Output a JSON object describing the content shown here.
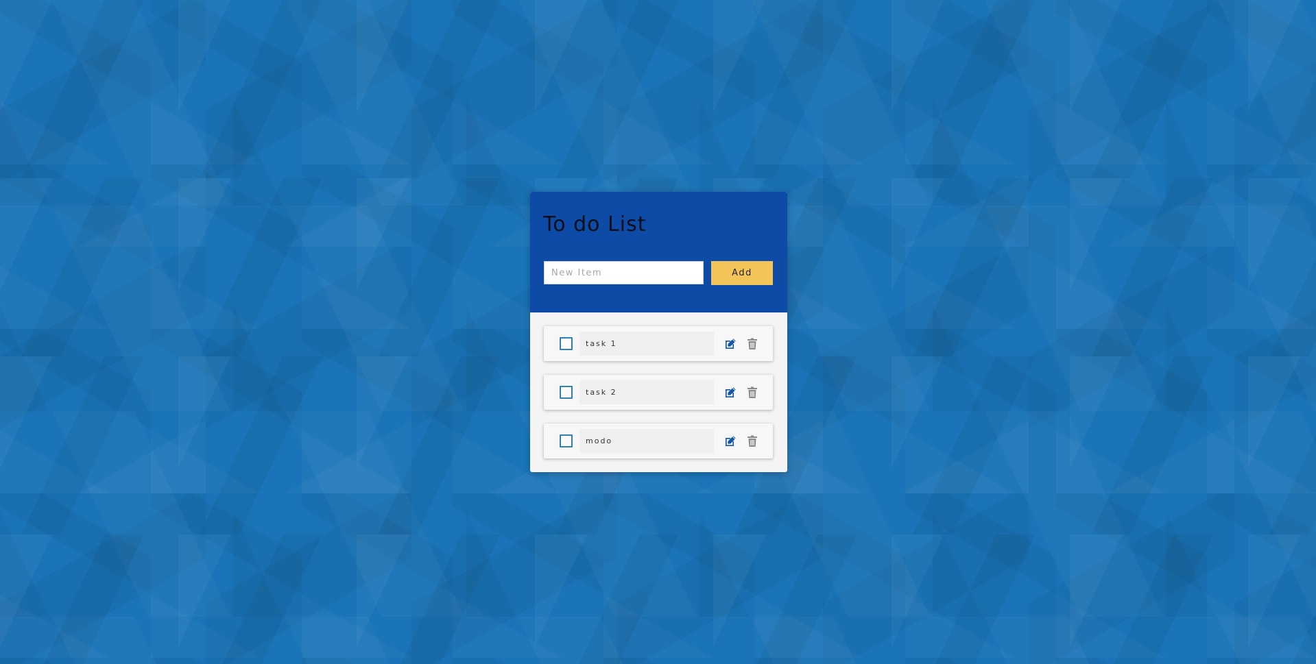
{
  "app": {
    "title": "To do List"
  },
  "form": {
    "input_value": "",
    "input_placeholder": "New Item",
    "add_label": "Add"
  },
  "tasks": [
    {
      "text": "task 1",
      "checked": false
    },
    {
      "text": "task 2",
      "checked": false
    },
    {
      "text": "modo",
      "checked": false
    }
  ],
  "icons": {
    "edit": "edit-icon",
    "delete": "trash-icon",
    "checkbox": "checkbox-unchecked"
  },
  "colors": {
    "background": "#1a74b7",
    "header": "#0d4ba6",
    "add_button": "#f2c45a",
    "card_body": "#f4f4f4",
    "edit_icon": "#1155a8",
    "delete_icon": "#8a8a8a",
    "checkbox_border": "#2f7fb8"
  }
}
